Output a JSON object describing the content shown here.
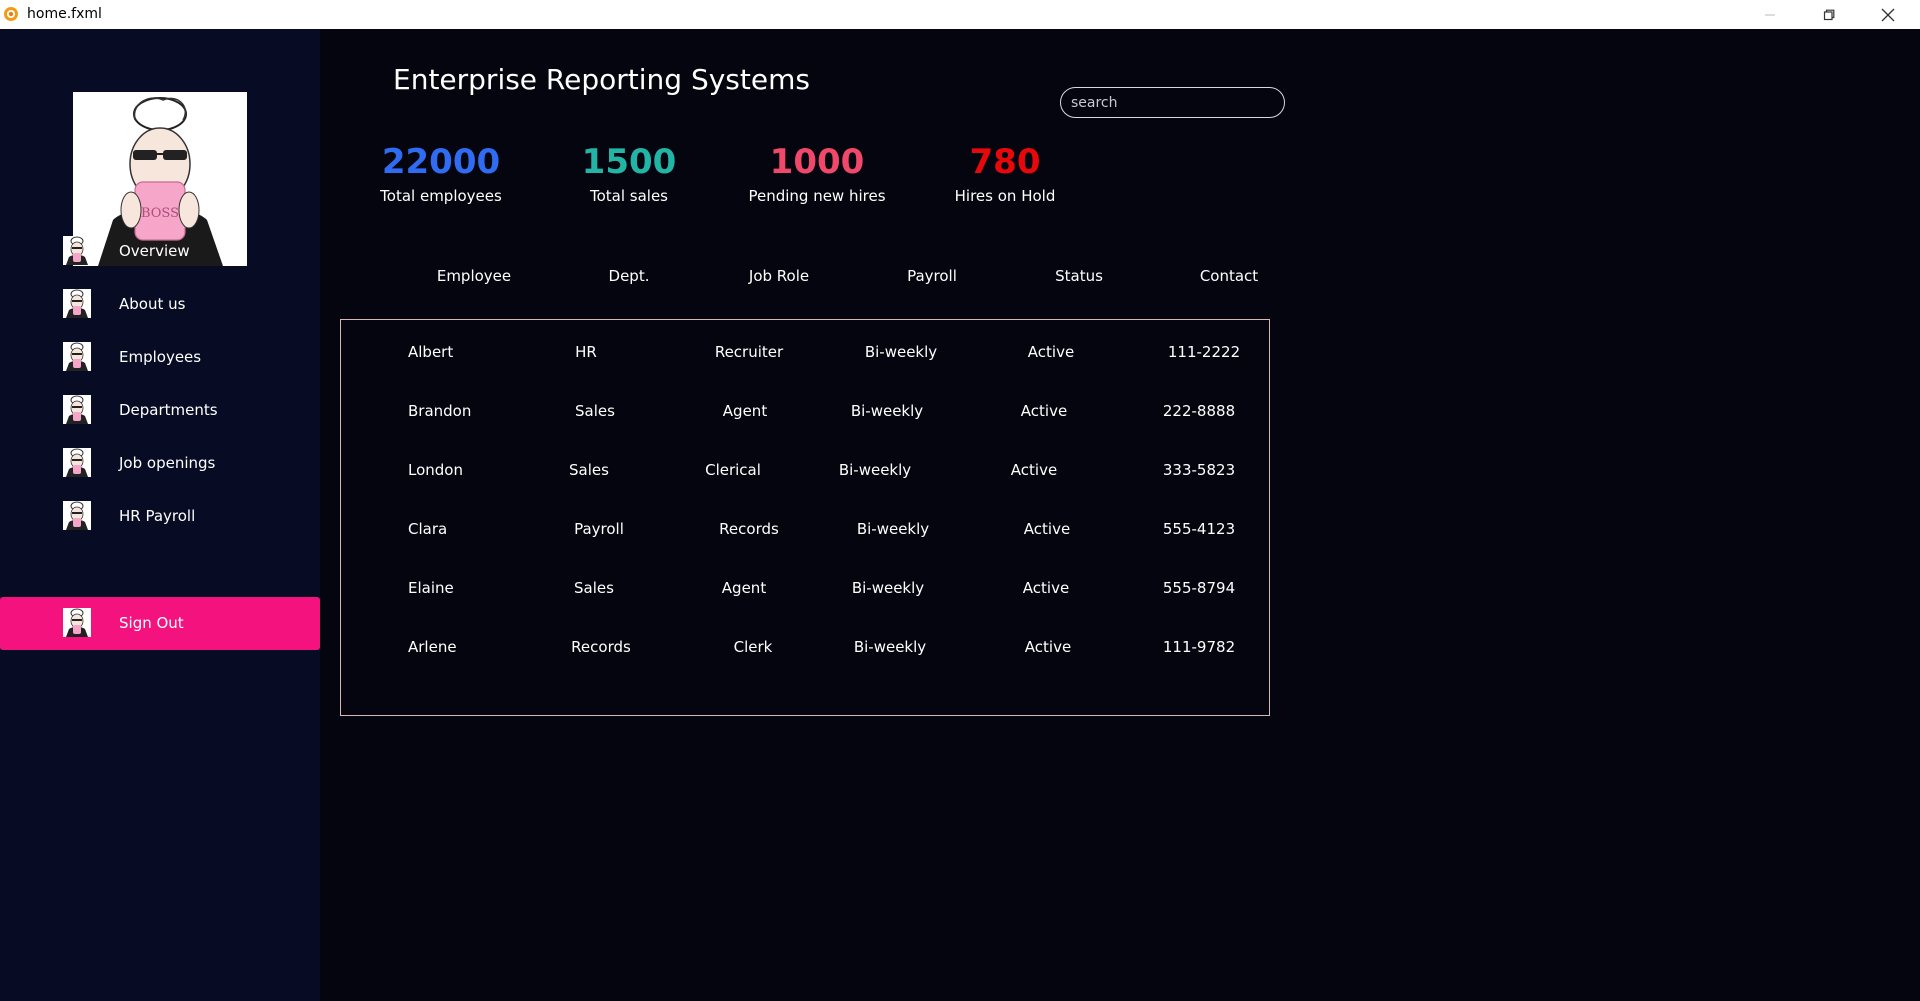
{
  "window": {
    "title": "home.fxml",
    "minimize_icon": "minimize-icon",
    "maximize_icon": "restore-icon",
    "close_icon": "close-icon"
  },
  "sidebar": {
    "avatar": "boss-illustration",
    "items": [
      {
        "label": "Overview",
        "icon": "boss-avatar-icon",
        "active": false
      },
      {
        "label": "About us",
        "icon": "boss-avatar-icon",
        "active": false
      },
      {
        "label": "Employees",
        "icon": "boss-avatar-icon",
        "active": false
      },
      {
        "label": "Departments",
        "icon": "boss-avatar-icon",
        "active": false
      },
      {
        "label": "Job openings",
        "icon": "boss-avatar-icon",
        "active": false
      },
      {
        "label": "HR Payroll",
        "icon": "boss-avatar-icon",
        "active": false
      },
      {
        "label": "Sign Out",
        "icon": "boss-avatar-icon",
        "active": true
      }
    ]
  },
  "header": {
    "title": "Enterprise Reporting Systems",
    "search_placeholder": "search"
  },
  "stats": [
    {
      "value": "22000",
      "label": "Total employees",
      "color": "#2f6cf2"
    },
    {
      "value": "1500",
      "label": "Total sales",
      "color": "#22b5a6"
    },
    {
      "value": "1000",
      "label": "Pending new hires",
      "color": "#f0486a"
    },
    {
      "value": "780",
      "label": "Hires on Hold",
      "color": "#e8080c"
    }
  ],
  "table": {
    "columns": [
      "Employee",
      "Dept.",
      "Job Role",
      "Payroll",
      "Status",
      "Contact"
    ],
    "rows": [
      [
        "Albert",
        "HR",
        "Recruiter",
        "Bi-weekly",
        "Active",
        "111-2222"
      ],
      [
        "Brandon",
        "Sales",
        "Agent",
        "Bi-weekly",
        "Active",
        "222-8888"
      ],
      [
        "London",
        "Sales",
        "Clerical",
        "Bi-weekly",
        "Active",
        "333-5823"
      ],
      [
        "Clara",
        "Payroll",
        "Records",
        "Bi-weekly",
        "Active",
        "555-4123"
      ],
      [
        "Elaine",
        "Sales",
        "Agent",
        "Bi-weekly",
        "Active",
        "555-8794"
      ],
      [
        "Arlene",
        "Records",
        "Clerk",
        "Bi-weekly",
        "Active",
        "111-9782"
      ]
    ]
  },
  "colors": {
    "sidebar_bg": "#070b24",
    "main_bg": "#05050f",
    "active_nav": "#f4127f",
    "table_border": "#d9b8b3"
  }
}
